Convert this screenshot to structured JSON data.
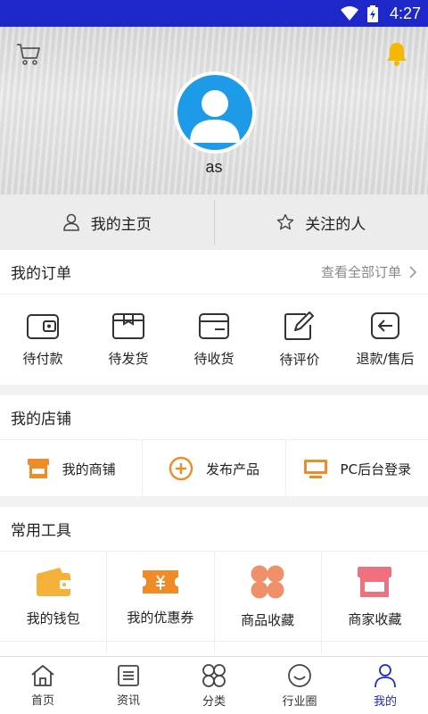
{
  "status_bar": {
    "time": "4:27"
  },
  "profile": {
    "username": "as"
  },
  "profile_tabs": {
    "homepage": "我的主页",
    "following": "关注的人"
  },
  "orders": {
    "title": "我的订单",
    "view_all": "查看全部订单",
    "items": [
      {
        "label": "待付款",
        "icon": "wallet-icon"
      },
      {
        "label": "待发货",
        "icon": "package-icon"
      },
      {
        "label": "待收货",
        "icon": "receive-icon"
      },
      {
        "label": "待评价",
        "icon": "review-icon"
      },
      {
        "label": "退款/售后",
        "icon": "refund-icon"
      }
    ]
  },
  "shop": {
    "title": "我的店铺",
    "items": [
      {
        "label": "我的商铺",
        "icon": "store-icon"
      },
      {
        "label": "发布产品",
        "icon": "add-circle-icon"
      },
      {
        "label": "PC后台登录",
        "icon": "monitor-icon"
      }
    ]
  },
  "tools": {
    "title": "常用工具",
    "items": [
      {
        "label": "我的钱包",
        "icon": "wallet-icon"
      },
      {
        "label": "我的优惠券",
        "icon": "coupon-icon"
      },
      {
        "label": "商品收藏",
        "icon": "clover-icon"
      },
      {
        "label": "商家收藏",
        "icon": "store-icon"
      }
    ]
  },
  "bottom_nav": [
    {
      "label": "首页",
      "icon": "home-icon"
    },
    {
      "label": "资讯",
      "icon": "news-icon"
    },
    {
      "label": "分类",
      "icon": "category-icon"
    },
    {
      "label": "行业圈",
      "icon": "smile-icon"
    },
    {
      "label": "我的",
      "icon": "person-icon",
      "active": true
    }
  ],
  "colors": {
    "accent": "#1e28c8",
    "avatar": "#1e9be8",
    "orange": "#f08c28",
    "wallet": "#f5b13a",
    "clover": "#f0906a",
    "shop_pink": "#f07080"
  }
}
